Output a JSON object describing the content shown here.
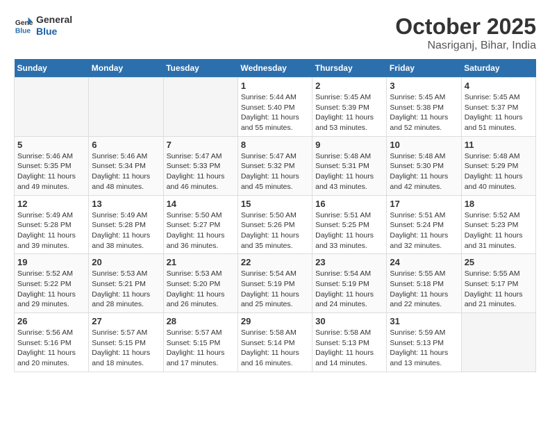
{
  "header": {
    "logo_line1": "General",
    "logo_line2": "Blue",
    "month": "October 2025",
    "location": "Nasriganj, Bihar, India"
  },
  "days_of_week": [
    "Sunday",
    "Monday",
    "Tuesday",
    "Wednesday",
    "Thursday",
    "Friday",
    "Saturday"
  ],
  "weeks": [
    [
      {
        "day": "",
        "empty": true
      },
      {
        "day": "",
        "empty": true
      },
      {
        "day": "",
        "empty": true
      },
      {
        "day": "1",
        "sunrise": "Sunrise: 5:44 AM",
        "sunset": "Sunset: 5:40 PM",
        "daylight": "Daylight: 11 hours and 55 minutes."
      },
      {
        "day": "2",
        "sunrise": "Sunrise: 5:45 AM",
        "sunset": "Sunset: 5:39 PM",
        "daylight": "Daylight: 11 hours and 53 minutes."
      },
      {
        "day": "3",
        "sunrise": "Sunrise: 5:45 AM",
        "sunset": "Sunset: 5:38 PM",
        "daylight": "Daylight: 11 hours and 52 minutes."
      },
      {
        "day": "4",
        "sunrise": "Sunrise: 5:45 AM",
        "sunset": "Sunset: 5:37 PM",
        "daylight": "Daylight: 11 hours and 51 minutes."
      }
    ],
    [
      {
        "day": "5",
        "sunrise": "Sunrise: 5:46 AM",
        "sunset": "Sunset: 5:35 PM",
        "daylight": "Daylight: 11 hours and 49 minutes."
      },
      {
        "day": "6",
        "sunrise": "Sunrise: 5:46 AM",
        "sunset": "Sunset: 5:34 PM",
        "daylight": "Daylight: 11 hours and 48 minutes."
      },
      {
        "day": "7",
        "sunrise": "Sunrise: 5:47 AM",
        "sunset": "Sunset: 5:33 PM",
        "daylight": "Daylight: 11 hours and 46 minutes."
      },
      {
        "day": "8",
        "sunrise": "Sunrise: 5:47 AM",
        "sunset": "Sunset: 5:32 PM",
        "daylight": "Daylight: 11 hours and 45 minutes."
      },
      {
        "day": "9",
        "sunrise": "Sunrise: 5:48 AM",
        "sunset": "Sunset: 5:31 PM",
        "daylight": "Daylight: 11 hours and 43 minutes."
      },
      {
        "day": "10",
        "sunrise": "Sunrise: 5:48 AM",
        "sunset": "Sunset: 5:30 PM",
        "daylight": "Daylight: 11 hours and 42 minutes."
      },
      {
        "day": "11",
        "sunrise": "Sunrise: 5:48 AM",
        "sunset": "Sunset: 5:29 PM",
        "daylight": "Daylight: 11 hours and 40 minutes."
      }
    ],
    [
      {
        "day": "12",
        "sunrise": "Sunrise: 5:49 AM",
        "sunset": "Sunset: 5:28 PM",
        "daylight": "Daylight: 11 hours and 39 minutes."
      },
      {
        "day": "13",
        "sunrise": "Sunrise: 5:49 AM",
        "sunset": "Sunset: 5:28 PM",
        "daylight": "Daylight: 11 hours and 38 minutes."
      },
      {
        "day": "14",
        "sunrise": "Sunrise: 5:50 AM",
        "sunset": "Sunset: 5:27 PM",
        "daylight": "Daylight: 11 hours and 36 minutes."
      },
      {
        "day": "15",
        "sunrise": "Sunrise: 5:50 AM",
        "sunset": "Sunset: 5:26 PM",
        "daylight": "Daylight: 11 hours and 35 minutes."
      },
      {
        "day": "16",
        "sunrise": "Sunrise: 5:51 AM",
        "sunset": "Sunset: 5:25 PM",
        "daylight": "Daylight: 11 hours and 33 minutes."
      },
      {
        "day": "17",
        "sunrise": "Sunrise: 5:51 AM",
        "sunset": "Sunset: 5:24 PM",
        "daylight": "Daylight: 11 hours and 32 minutes."
      },
      {
        "day": "18",
        "sunrise": "Sunrise: 5:52 AM",
        "sunset": "Sunset: 5:23 PM",
        "daylight": "Daylight: 11 hours and 31 minutes."
      }
    ],
    [
      {
        "day": "19",
        "sunrise": "Sunrise: 5:52 AM",
        "sunset": "Sunset: 5:22 PM",
        "daylight": "Daylight: 11 hours and 29 minutes."
      },
      {
        "day": "20",
        "sunrise": "Sunrise: 5:53 AM",
        "sunset": "Sunset: 5:21 PM",
        "daylight": "Daylight: 11 hours and 28 minutes."
      },
      {
        "day": "21",
        "sunrise": "Sunrise: 5:53 AM",
        "sunset": "Sunset: 5:20 PM",
        "daylight": "Daylight: 11 hours and 26 minutes."
      },
      {
        "day": "22",
        "sunrise": "Sunrise: 5:54 AM",
        "sunset": "Sunset: 5:19 PM",
        "daylight": "Daylight: 11 hours and 25 minutes."
      },
      {
        "day": "23",
        "sunrise": "Sunrise: 5:54 AM",
        "sunset": "Sunset: 5:19 PM",
        "daylight": "Daylight: 11 hours and 24 minutes."
      },
      {
        "day": "24",
        "sunrise": "Sunrise: 5:55 AM",
        "sunset": "Sunset: 5:18 PM",
        "daylight": "Daylight: 11 hours and 22 minutes."
      },
      {
        "day": "25",
        "sunrise": "Sunrise: 5:55 AM",
        "sunset": "Sunset: 5:17 PM",
        "daylight": "Daylight: 11 hours and 21 minutes."
      }
    ],
    [
      {
        "day": "26",
        "sunrise": "Sunrise: 5:56 AM",
        "sunset": "Sunset: 5:16 PM",
        "daylight": "Daylight: 11 hours and 20 minutes."
      },
      {
        "day": "27",
        "sunrise": "Sunrise: 5:57 AM",
        "sunset": "Sunset: 5:15 PM",
        "daylight": "Daylight: 11 hours and 18 minutes."
      },
      {
        "day": "28",
        "sunrise": "Sunrise: 5:57 AM",
        "sunset": "Sunset: 5:15 PM",
        "daylight": "Daylight: 11 hours and 17 minutes."
      },
      {
        "day": "29",
        "sunrise": "Sunrise: 5:58 AM",
        "sunset": "Sunset: 5:14 PM",
        "daylight": "Daylight: 11 hours and 16 minutes."
      },
      {
        "day": "30",
        "sunrise": "Sunrise: 5:58 AM",
        "sunset": "Sunset: 5:13 PM",
        "daylight": "Daylight: 11 hours and 14 minutes."
      },
      {
        "day": "31",
        "sunrise": "Sunrise: 5:59 AM",
        "sunset": "Sunset: 5:13 PM",
        "daylight": "Daylight: 11 hours and 13 minutes."
      },
      {
        "day": "",
        "empty": true
      }
    ]
  ]
}
